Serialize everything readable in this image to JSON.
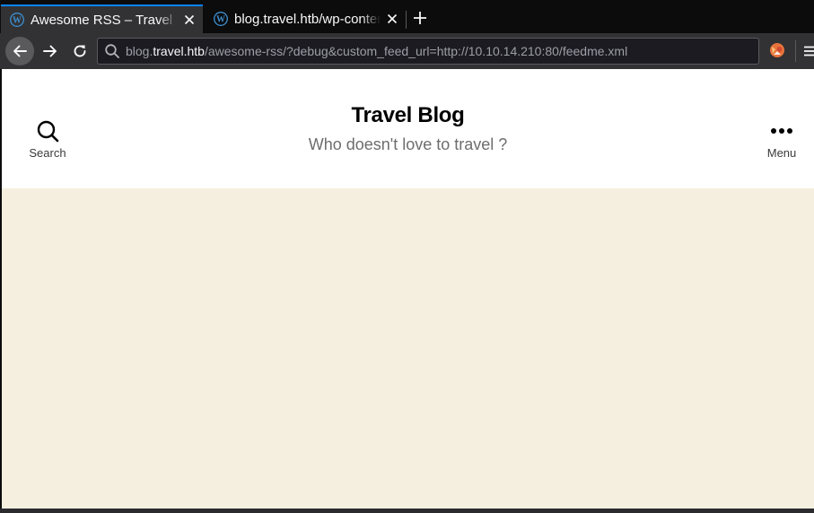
{
  "browser": {
    "tabs": [
      {
        "title": "Awesome RSS – Travel Blog",
        "favicon": "wordpress-icon",
        "active": true
      },
      {
        "title": "blog.travel.htb/wp-content/",
        "favicon": "wordpress-icon",
        "active": false
      }
    ],
    "new_tab_icon": "plus-icon",
    "url": {
      "prefix": "blog.",
      "domain": "travel.htb",
      "path": "/awesome-rss/?debug&custom_feed_url=http://10.10.14.210:80/feedme.xml"
    },
    "colors": {
      "tab_accent": "#0a84ff",
      "toolbar": "#323234",
      "tabstrip": "#0c0c0d"
    }
  },
  "site": {
    "title": "Travel Blog",
    "description": "Who doesn't love to travel ?",
    "search_label": "Search",
    "menu_label": "Menu",
    "colors": {
      "header_bg": "#ffffff",
      "body_bg": "#f5efe0"
    }
  }
}
